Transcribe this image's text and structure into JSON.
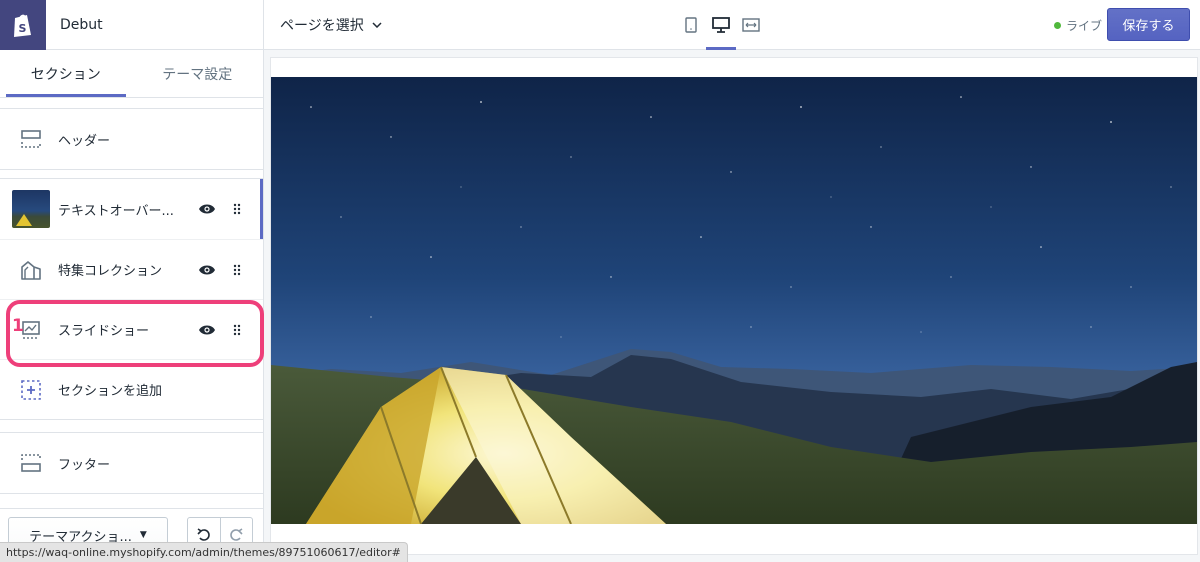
{
  "app": {
    "theme_name": "Debut"
  },
  "sidebar": {
    "tabs": [
      {
        "label": "セクション",
        "active": true
      },
      {
        "label": "テーマ設定",
        "active": false
      }
    ],
    "header_section": {
      "label": "ヘッダー"
    },
    "sections": [
      {
        "label": "テキストオーバー...",
        "icon": "image-thumbnail"
      },
      {
        "label": "特集コレクション",
        "icon": "collection-icon"
      },
      {
        "label": "スライドショー",
        "icon": "slideshow-icon"
      }
    ],
    "add_section": {
      "label": "セクションを追加"
    },
    "footer_section": {
      "label": "フッター"
    },
    "theme_actions": {
      "label": "テーマアクショ..."
    },
    "annotation_number": "1"
  },
  "topbar": {
    "page_select": "ページを選択",
    "devices": [
      "mobile",
      "desktop",
      "fullscreen"
    ],
    "live_label": "ライブ",
    "save_label": "保存する"
  },
  "statusbar": {
    "url": "https://waq-online.myshopify.com/admin/themes/89751060617/editor#"
  },
  "colors": {
    "accent": "#5c6ac4",
    "highlight": "#ee3f7a",
    "live": "#50b83c",
    "logo_bg": "#43467f"
  }
}
